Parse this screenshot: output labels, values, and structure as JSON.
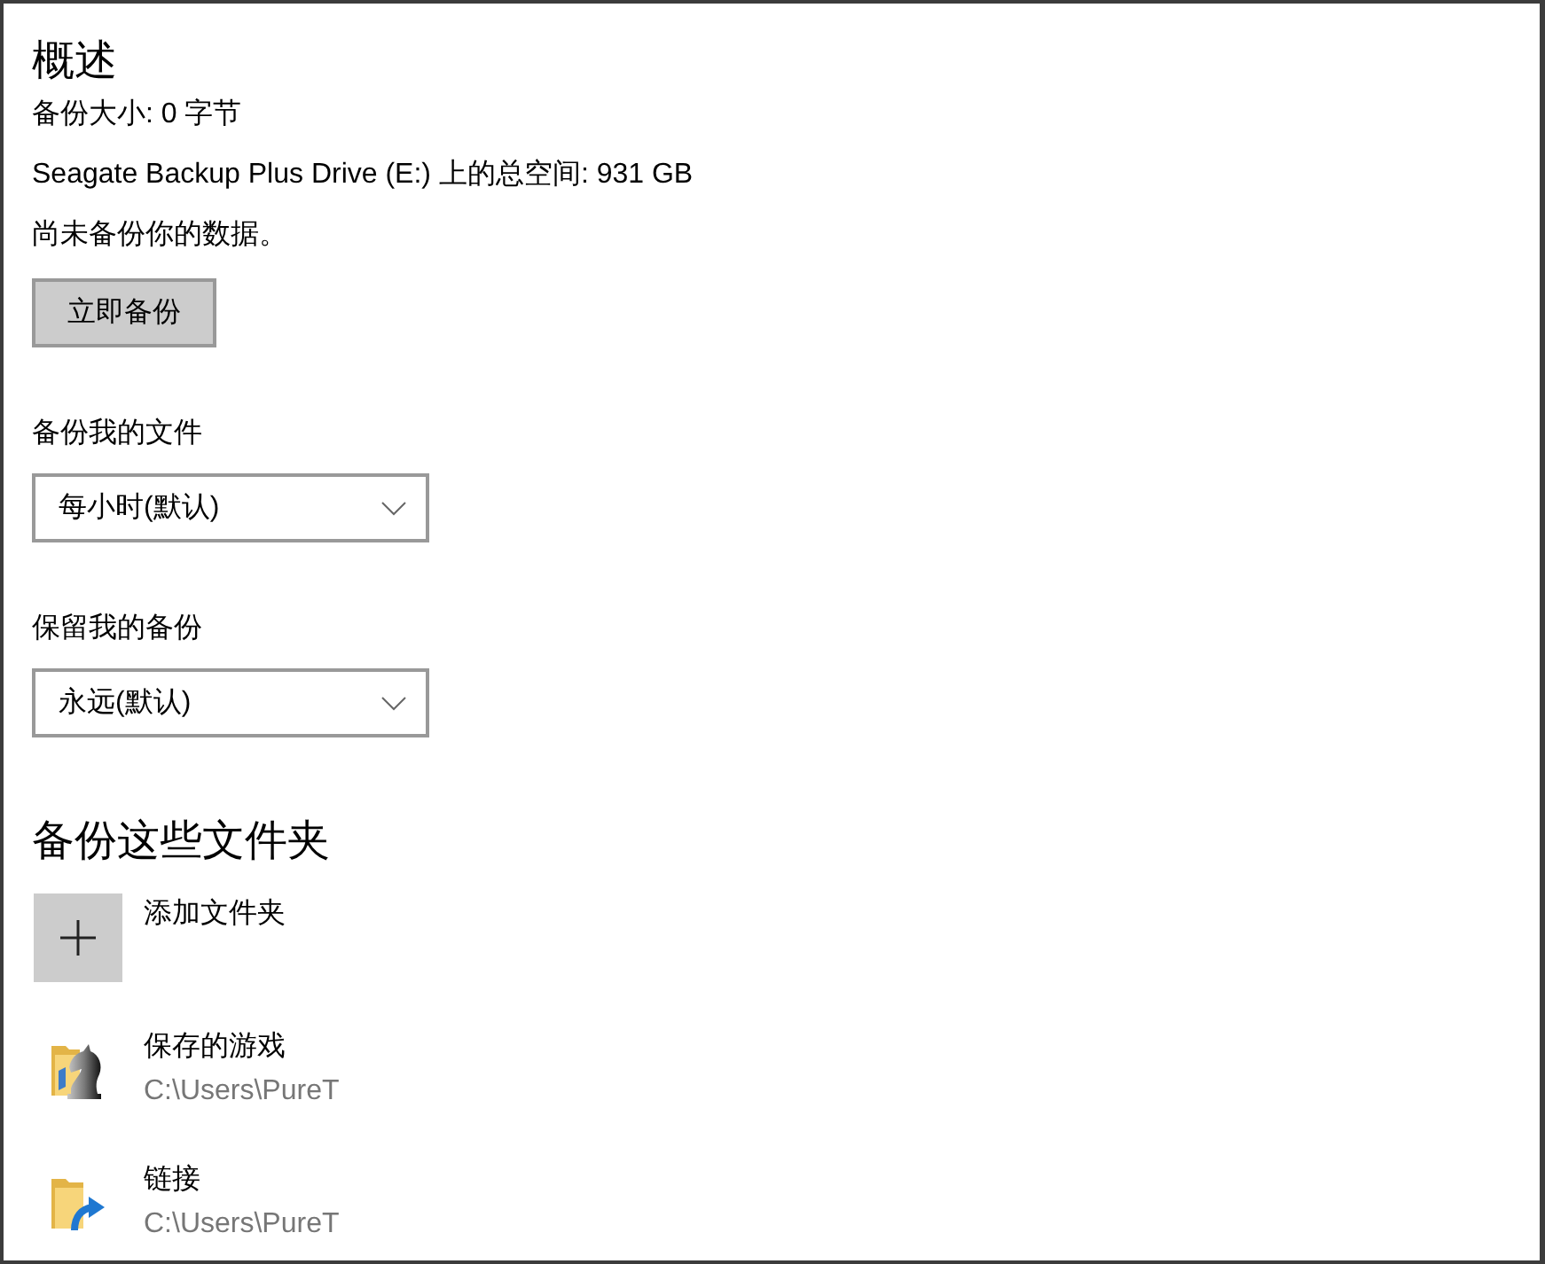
{
  "overview": {
    "title": "概述",
    "backup_size": "备份大小: 0 字节",
    "total_space": "Seagate Backup Plus Drive (E:) 上的总空间: 931 GB",
    "status": "尚未备份你的数据。",
    "backup_now_button": "立即备份"
  },
  "settings": [
    {
      "label": "备份我的文件",
      "value": "每小时(默认)"
    },
    {
      "label": "保留我的备份",
      "value": "永远(默认)"
    }
  ],
  "folders_section": {
    "title": "备份这些文件夹",
    "add_folder": "添加文件夹",
    "folders": [
      {
        "kind": "saved-games",
        "name": "保存的游戏",
        "path": "C:\\Users\\PureT"
      },
      {
        "kind": "links",
        "name": "链接",
        "path": "C:\\Users\\PureT"
      }
    ]
  }
}
